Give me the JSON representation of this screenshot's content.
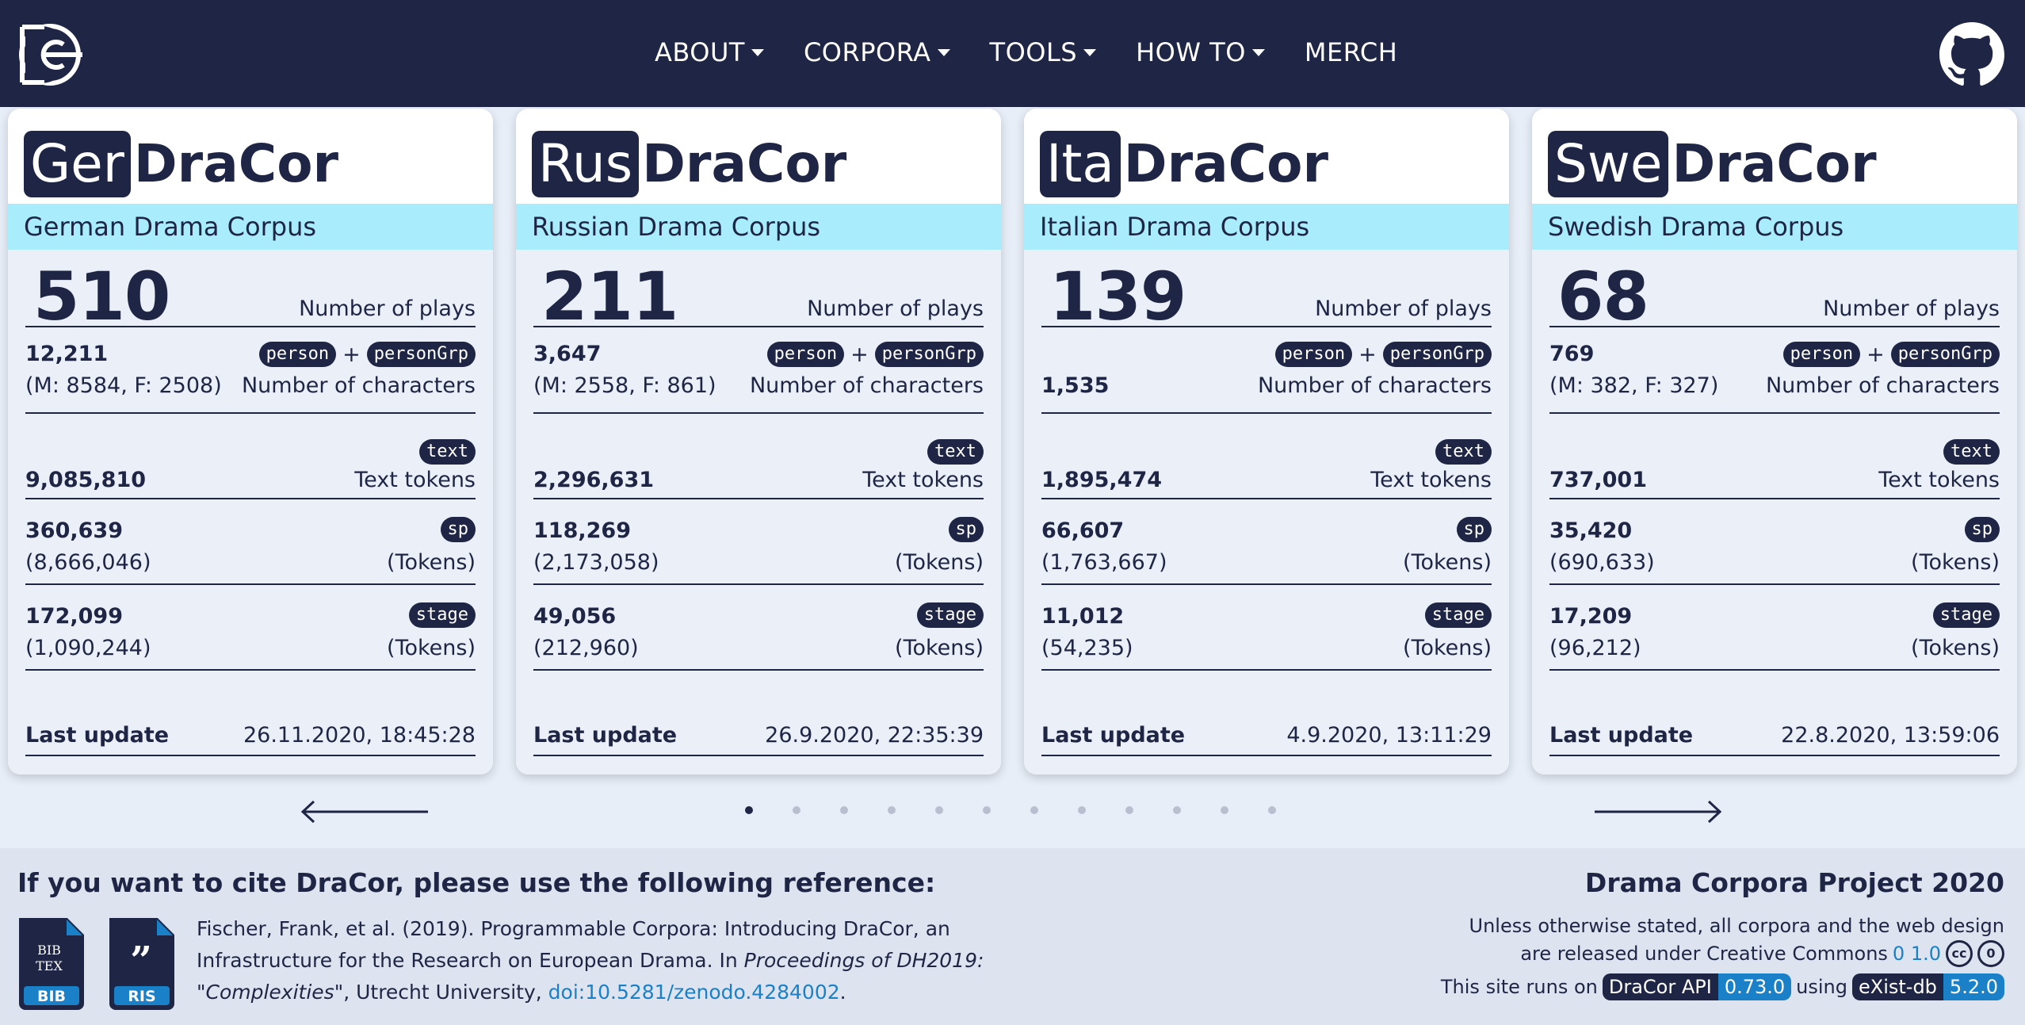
{
  "nav": {
    "items": [
      "ABOUT",
      "CORPORA",
      "TOOLS",
      "HOW TO",
      "MERCH"
    ],
    "dropdown": [
      true,
      true,
      true,
      true,
      false
    ]
  },
  "cards": [
    {
      "prefix": "Ger",
      "suffix": "DraCor",
      "subtitle": "German Drama Corpus",
      "plays": "510",
      "plays_label": "Number of plays",
      "characters": "12,211",
      "characters_mf": "(M: 8584, F: 2508)",
      "tag_person": "person",
      "plus": "+",
      "tag_persongrp": "personGrp",
      "characters_label": "Number of characters",
      "tag_text": "text",
      "text_tokens": "9,085,810",
      "text_tokens_label": "Text tokens",
      "sp": "360,639",
      "sp_tokens": "(8,666,046)",
      "tag_sp": "sp",
      "tokens_label": "(Tokens)",
      "stage": "172,099",
      "stage_tokens": "(1,090,244)",
      "tag_stage": "stage",
      "last_update_label": "Last update",
      "last_update": "26.11.2020, 18:45:28"
    },
    {
      "prefix": "Rus",
      "suffix": "DraCor",
      "subtitle": "Russian Drama Corpus",
      "plays": "211",
      "plays_label": "Number of plays",
      "characters": "3,647",
      "characters_mf": "(M: 2558, F: 861)",
      "tag_person": "person",
      "plus": "+",
      "tag_persongrp": "personGrp",
      "characters_label": "Number of characters",
      "tag_text": "text",
      "text_tokens": "2,296,631",
      "text_tokens_label": "Text tokens",
      "sp": "118,269",
      "sp_tokens": "(2,173,058)",
      "tag_sp": "sp",
      "tokens_label": "(Tokens)",
      "stage": "49,056",
      "stage_tokens": "(212,960)",
      "tag_stage": "stage",
      "last_update_label": "Last update",
      "last_update": "26.9.2020, 22:35:39"
    },
    {
      "prefix": "Ita",
      "suffix": "DraCor",
      "subtitle": "Italian Drama Corpus",
      "plays": "139",
      "plays_label": "Number of plays",
      "characters": "",
      "characters_mf": "1,535",
      "tag_person": "person",
      "plus": "+",
      "tag_persongrp": "personGrp",
      "characters_label": "Number of characters",
      "tag_text": "text",
      "text_tokens": "1,895,474",
      "text_tokens_label": "Text tokens",
      "sp": "66,607",
      "sp_tokens": "(1,763,667)",
      "tag_sp": "sp",
      "tokens_label": "(Tokens)",
      "stage": "11,012",
      "stage_tokens": "(54,235)",
      "tag_stage": "stage",
      "last_update_label": "Last update",
      "last_update": "4.9.2020, 13:11:29"
    },
    {
      "prefix": "Swe",
      "suffix": "DraCor",
      "subtitle": "Swedish Drama Corpus",
      "plays": "68",
      "plays_label": "Number of plays",
      "characters": "769",
      "characters_mf": "(M: 382, F: 327)",
      "tag_person": "person",
      "plus": "+",
      "tag_persongrp": "personGrp",
      "characters_label": "Number of characters",
      "tag_text": "text",
      "text_tokens": "737,001",
      "text_tokens_label": "Text tokens",
      "sp": "35,420",
      "sp_tokens": "(690,633)",
      "tag_sp": "sp",
      "tokens_label": "(Tokens)",
      "stage": "17,209",
      "stage_tokens": "(96,212)",
      "tag_stage": "stage",
      "last_update_label": "Last update",
      "last_update": "22.8.2020, 13:59:06"
    }
  ],
  "carousel": {
    "dot_count": 12,
    "active_index": 0
  },
  "footer": {
    "cite_title": "If you want to cite DraCor, please use the following reference:",
    "bib_label": "BIB",
    "bib_glyph": "BIBTEX",
    "ris_label": "RIS",
    "ris_glyph": "❞",
    "cite_part1": "Fischer, Frank, et al. (2019). Programmable Corpora: Introducing DraCor, an Infrastructure for the Research on European Drama. In ",
    "cite_italic": "Proceedings of DH2019: \"Complexities\"",
    "cite_part2": ", Utrecht University, ",
    "cite_doi": "doi:10.5281/zenodo.4284002",
    "cite_end": ".",
    "project_title": "Drama Corpora Project 2020",
    "license_line1": "Unless otherwise stated, all corpora and the web design",
    "license_line2": "are released under Creative Commons",
    "license_version": "0 1.0",
    "runs_on": "This site runs on",
    "api_name": "DraCor API",
    "api_version": "0.73.0",
    "using": "using",
    "db_name": "eXist-db",
    "db_version": "5.2.0"
  },
  "colors": {
    "navy": "#1f2544",
    "cyan": "#a9ecfb",
    "link": "#1a80c8"
  }
}
